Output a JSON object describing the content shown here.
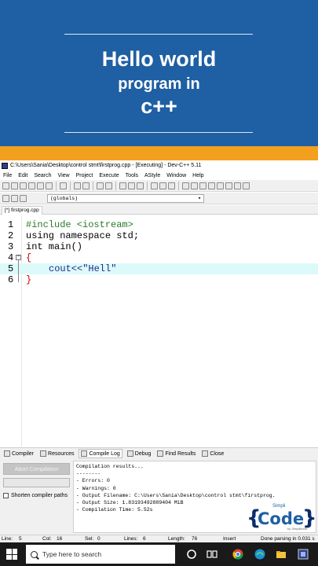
{
  "banner": {
    "line1": "Hello world",
    "line2": "program in",
    "line3": "c++",
    "bg_color": "#1f5fa3",
    "stripe_color": "#f2a01e"
  },
  "window": {
    "title": "C:\\Users\\Sania\\Desktop\\control stmt\\firstprog.cpp - [Executing] - Dev-C++ 5.11"
  },
  "menu": [
    "File",
    "Edit",
    "Search",
    "View",
    "Project",
    "Execute",
    "Tools",
    "AStyle",
    "Window",
    "Help"
  ],
  "toolbar2": {
    "scope": "(globals)"
  },
  "tabs": {
    "file_tab": "[*] firstprog.cpp"
  },
  "editor": {
    "lines": [
      {
        "num": "1",
        "code": "#include <iostream>"
      },
      {
        "num": "2",
        "code": "using namespace std;"
      },
      {
        "num": "3",
        "code": "int main()"
      },
      {
        "num": "4",
        "code": "{"
      },
      {
        "num": "5",
        "code": "cout<<\"Hell\""
      },
      {
        "num": "6",
        "code": "}"
      }
    ],
    "active_line": 5
  },
  "bottom_tabs": [
    "Compiler",
    "Resources",
    "Compile Log",
    "Debug",
    "Find Results",
    "Close"
  ],
  "bottom_panel": {
    "abort_label": "Abort Compilation",
    "shorten_label": "Shorten compiler paths",
    "log": [
      "Compilation results...",
      "--------",
      "- Errors: 0",
      "- Warnings: 0",
      "- Output Filename: C:\\Users\\Sania\\Desktop\\control stmt\\firstprog.",
      "- Output Size: 1.83193492889404 MiB",
      "- Compilation Time: 5.52s"
    ]
  },
  "logo": {
    "simpli": "Simpli",
    "code": "Code",
    "by": "by Simplilearn"
  },
  "status": {
    "line_label": "Line:",
    "line_val": "5",
    "col_label": "Col:",
    "col_val": "16",
    "sel_label": "Sel:",
    "sel_val": "0",
    "lines_label": "Lines:",
    "lines_val": "6",
    "length_label": "Length:",
    "length_val": "76",
    "mode": "Insert",
    "parse": "Done parsing in 0.031 s"
  },
  "taskbar": {
    "search_placeholder": "Type here to search"
  }
}
